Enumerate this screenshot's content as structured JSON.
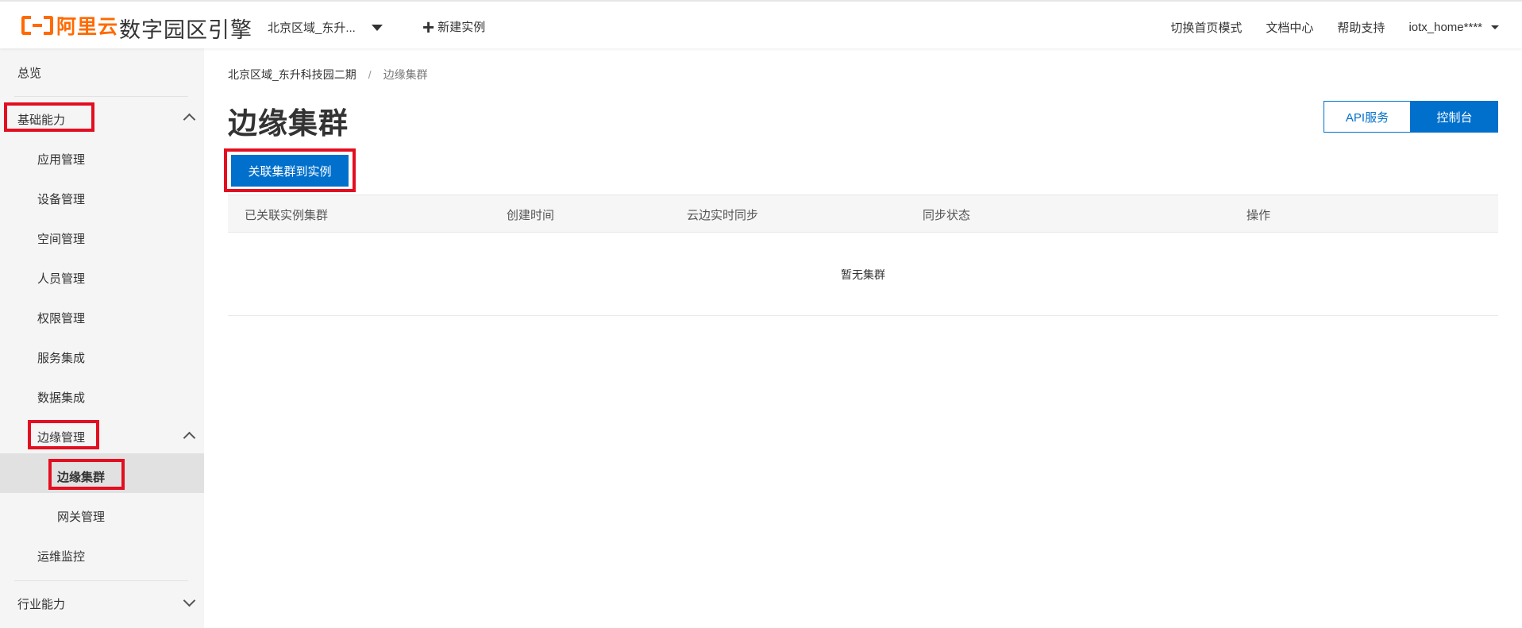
{
  "header": {
    "logo_text": "阿里云",
    "product_name": "数字园区引擎",
    "region": "北京区域_东升...",
    "new_instance": "新建实例",
    "nav": [
      "切换首页模式",
      "文档中心",
      "帮助支持"
    ],
    "user": "iotx_home****"
  },
  "sidebar": {
    "overview": "总览",
    "basic": "基础能力",
    "items": [
      "应用管理",
      "设备管理",
      "空间管理",
      "人员管理",
      "权限管理",
      "服务集成",
      "数据集成"
    ],
    "edge": "边缘管理",
    "edge_children": [
      "边缘集群",
      "网关管理"
    ],
    "ops": "运维监控",
    "industry": "行业能力"
  },
  "main": {
    "breadcrumb": [
      "北京区域_东升科技园二期",
      "边缘集群"
    ],
    "title": "边缘集群",
    "switch_buttons": [
      "API服务",
      "控制台"
    ],
    "primary_button": "关联集群到实例",
    "table": {
      "columns": [
        "已关联实例集群",
        "创建时间",
        "云边实时同步",
        "同步状态",
        "操作"
      ],
      "empty": "暂无集群"
    }
  },
  "colors": {
    "brand": "#ff6a00",
    "primary": "#0070cc",
    "highlight": "#e30e20"
  }
}
